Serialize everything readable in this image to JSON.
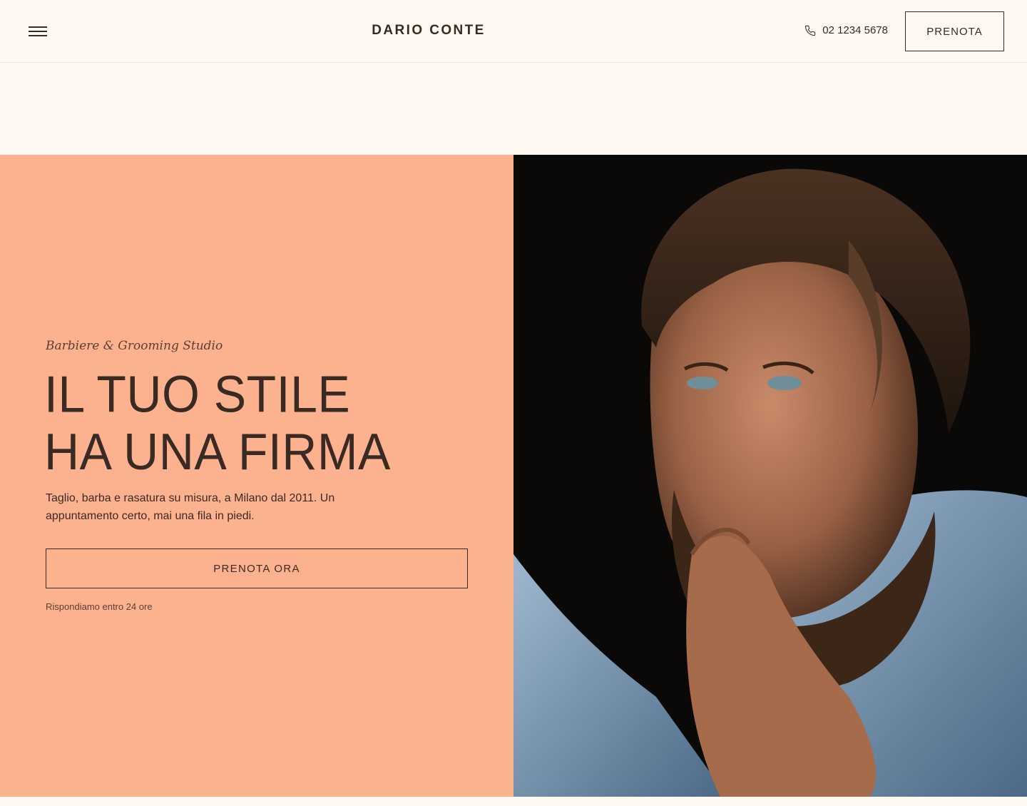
{
  "header": {
    "brand": "DARIO CONTE",
    "phone": "02 1234 5678",
    "cta_label": "PRENOTA"
  },
  "hero": {
    "eyebrow": "Barbiere & Grooming Studio",
    "headline_lines": [
      "IL TUO STILE",
      "HA UNA FIRMA"
    ],
    "description": "Taglio, barba e rasatura su misura, a Milano dal 2011. Un appuntamento certo, mai una fila in piedi.",
    "cta_label": "PRENOTA ORA",
    "note": "Rispondiamo entro 24 ore"
  },
  "icons": {
    "menu": "hamburger-menu-icon",
    "phone": "phone-icon"
  },
  "colors": {
    "page_background": "#fff9f1",
    "hero_panel": "#fdb28f",
    "text": "#3a2a24"
  }
}
